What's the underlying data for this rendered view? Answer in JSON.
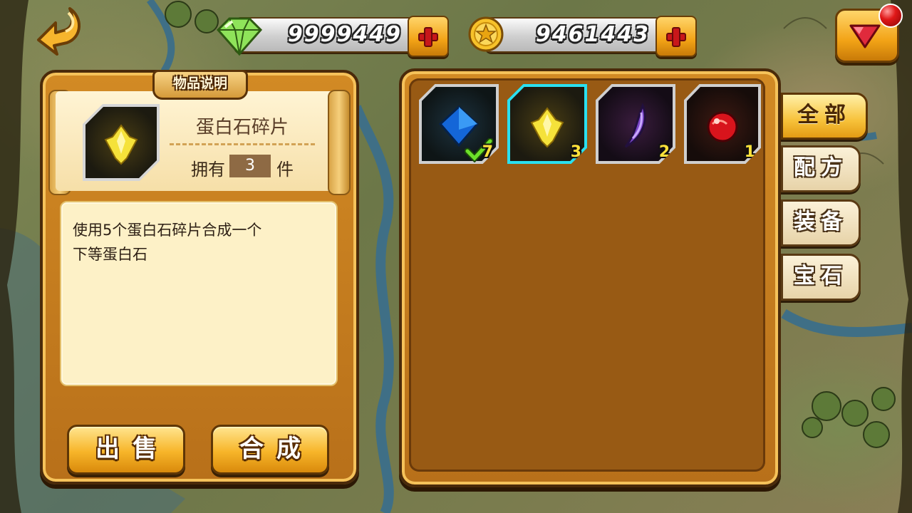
{
  "top_bar": {
    "gems": "9999449",
    "coins": "9461443",
    "back_icon": "back-arrow-icon",
    "gem_icon": "green-diamond-icon",
    "coin_icon": "gold-coin-star-icon",
    "shop_icon": "red-heart-gem-icon"
  },
  "detail": {
    "title": "物品说明",
    "item_name": "蛋白石碎片",
    "own_label": "拥有",
    "own_count": "3",
    "own_unit": "件",
    "description_line1": "使用5个蛋白石碎片合成一个",
    "description_line2": "下等蛋白石",
    "sell_label": "出售",
    "craft_label": "合成"
  },
  "inventory": {
    "items": [
      {
        "name": "blue-gem-icon",
        "count": "7",
        "equipped": true,
        "selected": false
      },
      {
        "name": "opal-shard-icon",
        "count": "3",
        "equipped": false,
        "selected": true
      },
      {
        "name": "purple-fang-icon",
        "count": "2",
        "equipped": false,
        "selected": false
      },
      {
        "name": "red-orb-icon",
        "count": "1",
        "equipped": false,
        "selected": false
      }
    ]
  },
  "tabs": {
    "all": "全部",
    "recipe": "配方",
    "equipment": "装备",
    "gem": "宝石"
  },
  "colors": {
    "panel": "#b8701a",
    "accent": "#f7b529",
    "selected_slot": "#2ae0f0",
    "count_text": "#ffe23a"
  }
}
